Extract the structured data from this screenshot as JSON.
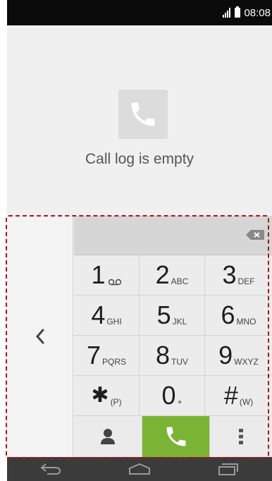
{
  "status_bar": {
    "time": "08:08",
    "signal_icon": "signal-bars-icon",
    "battery_icon": "battery-icon"
  },
  "call_log": {
    "empty_message": "Call log is empty",
    "icon": "phone-handset-icon"
  },
  "dialer": {
    "digits_value": "",
    "keys": [
      {
        "main": "1",
        "sub": "voicemail-icon"
      },
      {
        "main": "2",
        "sub": "ABC"
      },
      {
        "main": "3",
        "sub": "DEF"
      },
      {
        "main": "4",
        "sub": "GHI"
      },
      {
        "main": "5",
        "sub": "JKL"
      },
      {
        "main": "6",
        "sub": "MNO"
      },
      {
        "main": "7",
        "sub": "PQRS"
      },
      {
        "main": "8",
        "sub": "TUV"
      },
      {
        "main": "9",
        "sub": "WXYZ"
      },
      {
        "main": "✱",
        "sub": "(P)"
      },
      {
        "main": "0",
        "sub": "+"
      },
      {
        "main": "#",
        "sub": "(W)"
      }
    ],
    "collapse_icon": "chevron-left-icon",
    "call_color": "#7bb434"
  },
  "nav_bar": {
    "back_icon": "back-icon",
    "home_icon": "home-icon",
    "recents_icon": "recents-icon"
  },
  "colors": {
    "highlight_frame": "#b3121c",
    "status_bar_bg": "#0b0b0b",
    "nav_bar_bg": "#3b3b3b"
  }
}
